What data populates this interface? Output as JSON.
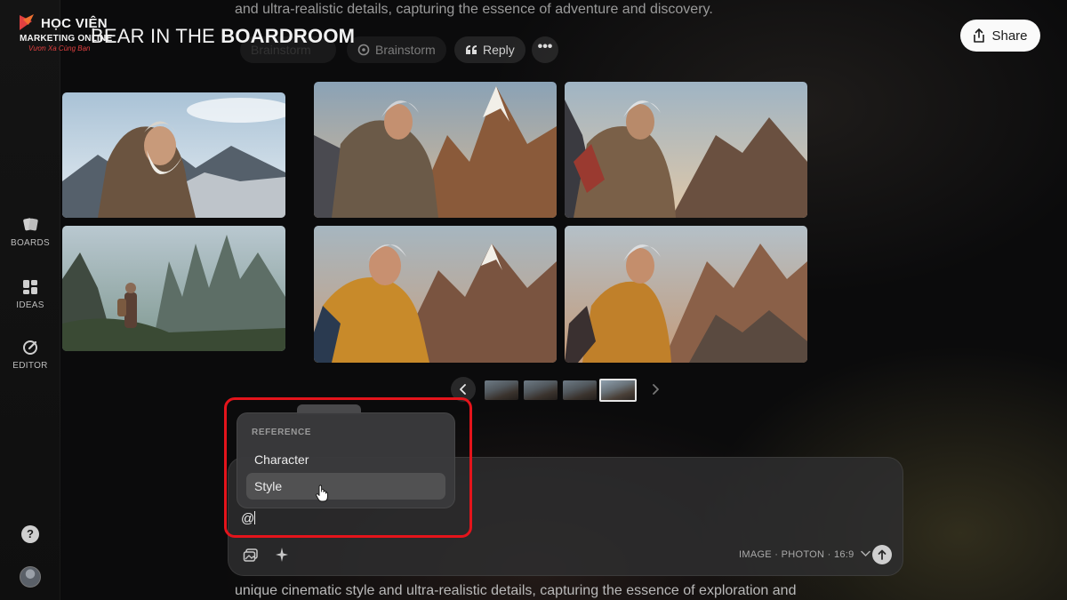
{
  "logo": {
    "line1": "HỌC VIỆN",
    "line2": "MARKETING ONLINE",
    "line3": "Vươn Xa Cùng Bạn"
  },
  "top_text": "and ultra-realistic details, capturing the essence of adventure and discovery.",
  "board": {
    "title_prefix": "BEAR IN THE ",
    "title_bold": "BOARDROOM"
  },
  "actions": {
    "faded_pill": "Brainstorm",
    "brainstorm": "Brainstorm",
    "reply": "Reply",
    "more": "•••"
  },
  "share_label": "Share",
  "sidebar": {
    "items": [
      {
        "label": "BOARDS",
        "icon": "boards-icon"
      },
      {
        "label": "IDEAS",
        "icon": "ideas-icon"
      },
      {
        "label": "EDITOR",
        "icon": "editor-icon"
      }
    ],
    "help": "?"
  },
  "reference_menu": {
    "header": "REFERENCE",
    "items": [
      "Character",
      "Style"
    ]
  },
  "prompt": {
    "value": "@",
    "mode": "IMAGE · PHOTON · 16:9"
  },
  "bottom_text": "unique cinematic style and ultra-realistic details, capturing the essence of exploration and",
  "colors": {
    "highlight_outline": "#e4141b",
    "logo_accent": "#e04040",
    "share_bg": "#fafafa"
  }
}
